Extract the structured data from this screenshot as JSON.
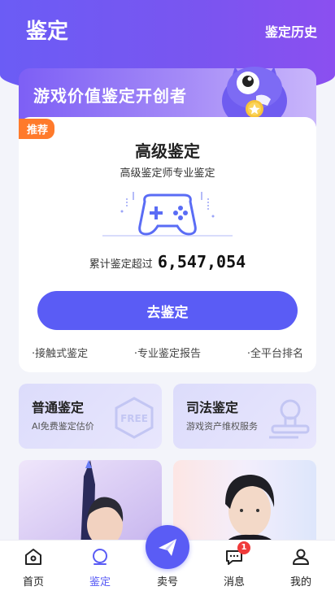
{
  "header": {
    "title": "鉴定",
    "history_label": "鉴定历史"
  },
  "banner": {
    "text": "游戏价值鉴定开创者"
  },
  "premium_card": {
    "tag": "推荐",
    "title": "高级鉴定",
    "subtitle": "高级鉴定师专业鉴定",
    "count_label": "累计鉴定超过",
    "count_value": "6,547,054",
    "button_label": "去鉴定",
    "features": [
      "·接触式鉴定",
      "·专业鉴定报告",
      "·全平台排名"
    ]
  },
  "service_cards": [
    {
      "title": "普通鉴定",
      "subtitle": "AI免费鉴定估价",
      "icon": "free-badge-icon",
      "deco_text": "FREE"
    },
    {
      "title": "司法鉴定",
      "subtitle": "游戏资产维权服务",
      "icon": "seal-stamp-icon"
    }
  ],
  "tabbar": {
    "items": [
      {
        "label": "首页",
        "icon": "home-icon"
      },
      {
        "label": "鉴定",
        "icon": "appraise-icon",
        "active": true
      },
      {
        "label": "卖号",
        "icon": "paper-plane-icon"
      },
      {
        "label": "消息",
        "icon": "message-icon",
        "badge": "1"
      },
      {
        "label": "我的",
        "icon": "profile-icon"
      }
    ]
  },
  "colors": {
    "primary": "#5a5cf5",
    "header": "#6b5cf5",
    "tag": "#ff7a2b",
    "badge": "#f03a3a"
  }
}
